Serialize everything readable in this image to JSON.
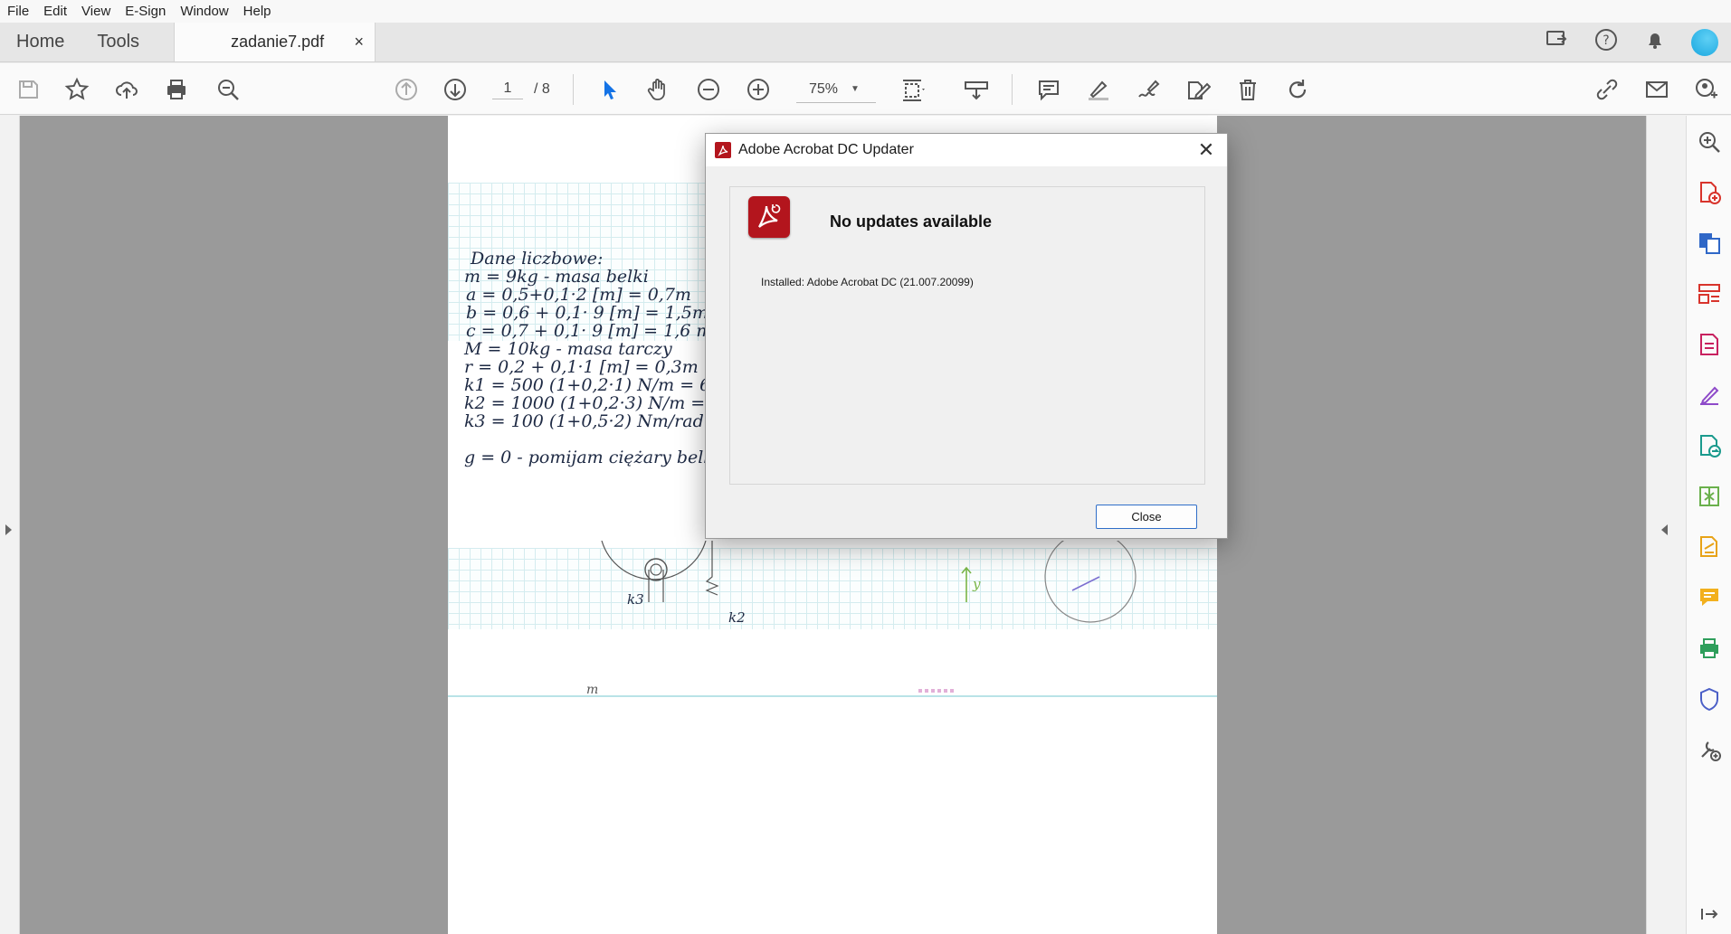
{
  "menu": [
    "File",
    "Edit",
    "View",
    "E-Sign",
    "Window",
    "Help"
  ],
  "tabs": {
    "home": "Home",
    "tools": "Tools",
    "document": "zadanie7.pdf",
    "close": "×"
  },
  "toolbar": {
    "page_current": "1",
    "page_total": "/ 8",
    "zoom": "75%"
  },
  "document_text": {
    "line1": "Dane liczbowe:",
    "line2": "m = 9kg - masa belki",
    "line3": "a = 0,5+0,1·2 [m] = 0,7m",
    "line4": "b = 0,6 + 0,1· 9 [m] = 1,5m",
    "line5": "c = 0,7 + 0,1· 9 [m] = 1,6 m",
    "line6": "M = 10kg - masa tarczy",
    "line7": "r = 0,2 + 0,1·1 [m] = 0,3m",
    "line8": "k1 = 500 (1+0,2·1) N/m = 600 N/m",
    "line9": "k2 = 1000 (1+0,2·3) N/m = 1600 N/m",
    "line10": "k3 = 100 (1+0,5·2) Nm/rad = 200",
    "line11": "g = 0 - pomijam ciężary belki i t",
    "k3_label": "k3",
    "k2_label": "k2",
    "y_label": "y",
    "m_label": "m"
  },
  "dialog": {
    "title": "Adobe Acrobat DC Updater",
    "heading": "No updates available",
    "installed": "Installed: Adobe Acrobat DC (21.007.20099)",
    "close_label": "Close",
    "close_x": "✕"
  },
  "colors": {
    "acrobat_red": "#b3151d",
    "accent_blue": "#1473e6",
    "avatar": "#29b6e8"
  }
}
